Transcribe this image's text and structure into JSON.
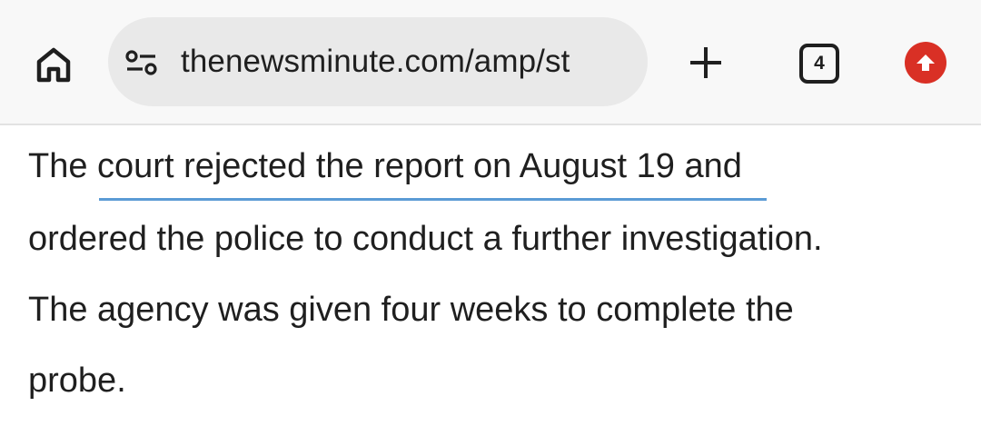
{
  "browser": {
    "home_icon": "home-icon",
    "site_info_icon": "tune-icon",
    "url": "thenewsminute.com/amp/st",
    "new_tab_icon": "plus-icon",
    "tab_count": "4",
    "update_icon": "arrow-up-icon",
    "colors": {
      "toolbar_bg": "#f8f8f8",
      "urlbar_bg": "#e9e9e9",
      "update_badge": "#d93025",
      "link_underline": "#5b9bd5"
    }
  },
  "article": {
    "lines": [
      "The court rejected the report on August 19 and",
      "ordered the police to conduct a further investigation.",
      "The agency was given four weeks to complete the",
      "probe."
    ]
  }
}
